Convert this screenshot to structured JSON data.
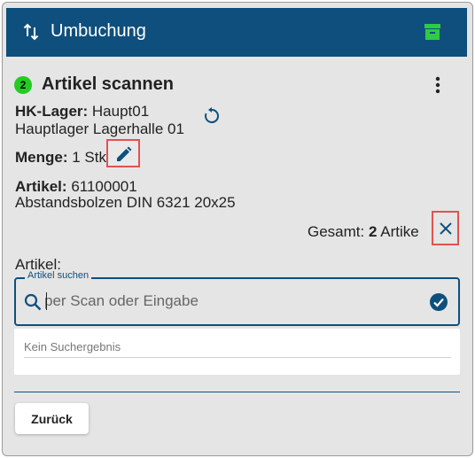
{
  "header": {
    "title": "Umbuchung",
    "left_icon": "swap-vertical-icon",
    "right_icon": "archive-box-icon",
    "accent": "#0e4f7d",
    "right_icon_color": "#2ecc40"
  },
  "step": {
    "number": "2",
    "title": "Artikel scannen",
    "badge_color": "#22cc22"
  },
  "hk_lager": {
    "label": "HK-Lager:",
    "value": "Haupt01",
    "detail": "Hauptlager Lagerhalle 01"
  },
  "menge": {
    "label": "Menge:",
    "value": "1 Stk"
  },
  "artikel": {
    "label": "Artikel:",
    "value": "61100001",
    "detail": "Abstandsbolzen DIN 6321 20x25"
  },
  "gesamt": {
    "prefix": "Gesamt:",
    "count": "2",
    "suffix": "Artike"
  },
  "search": {
    "section_label": "Artikel:",
    "legend": "Artikel suchen",
    "placeholder": "per Scan oder Eingabe",
    "value": ""
  },
  "results": {
    "empty_text": "Kein Suchergebnis"
  },
  "footer": {
    "back_label": "Zurück"
  }
}
